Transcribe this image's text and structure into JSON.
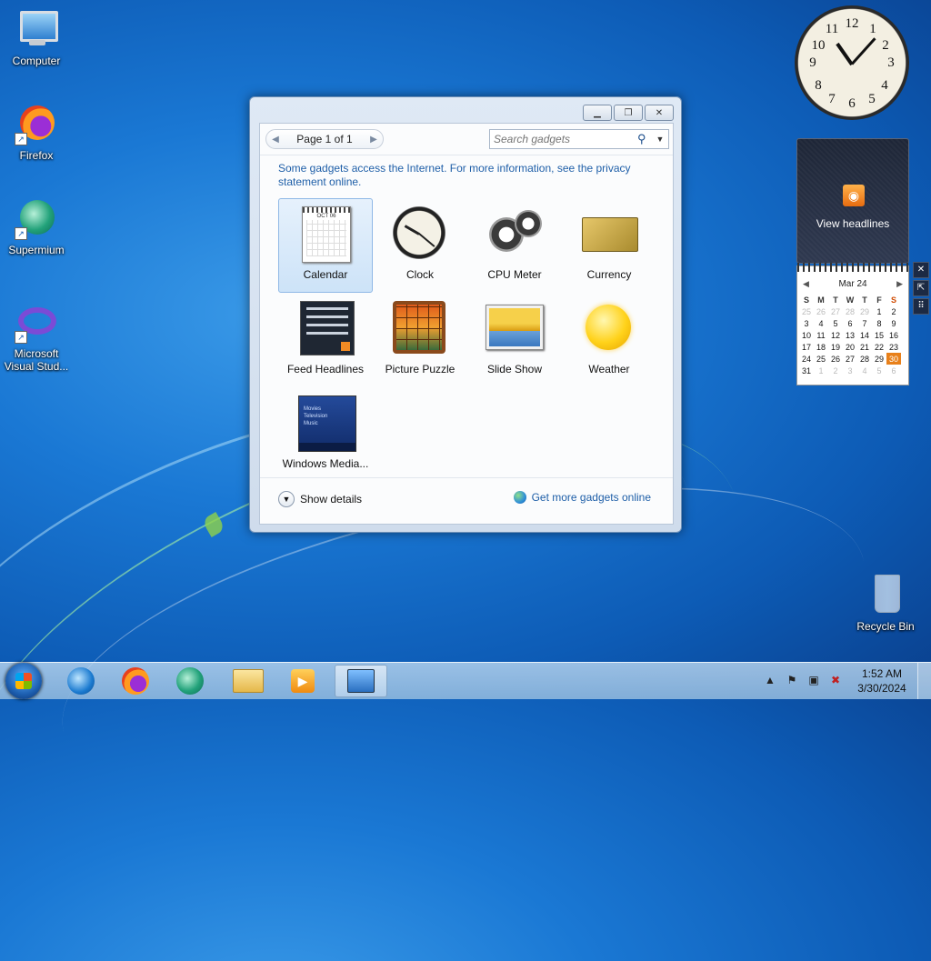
{
  "desktop": {
    "icons": [
      {
        "label": "Computer",
        "icon": "computer-icon"
      },
      {
        "label": "Firefox",
        "icon": "firefox-icon"
      },
      {
        "label": "Supermium",
        "icon": "supermium-icon"
      },
      {
        "label": "Microsoft Visual Stud...",
        "icon": "visual-studio-icon"
      },
      {
        "label": "Recycle Bin",
        "icon": "recycle-bin-icon"
      }
    ]
  },
  "gadget_window": {
    "pager_text": "Page 1 of 1",
    "search_placeholder": "Search gadgets",
    "notice_text": "Some gadgets access the Internet.  For more information, see the privacy statement online.",
    "gadgets": [
      {
        "label": "Calendar"
      },
      {
        "label": "Clock"
      },
      {
        "label": "CPU Meter"
      },
      {
        "label": "Currency"
      },
      {
        "label": "Feed Headlines"
      },
      {
        "label": "Picture Puzzle"
      },
      {
        "label": "Slide Show"
      },
      {
        "label": "Weather"
      },
      {
        "label": "Windows Media..."
      }
    ],
    "selected_gadget": "Calendar",
    "show_details": "Show details",
    "get_more": "Get more gadgets online",
    "calendar_thumb_month": "OCT 06"
  },
  "clock_gadget": {
    "numbers": [
      "12",
      "1",
      "2",
      "3",
      "4",
      "5",
      "6",
      "7",
      "8",
      "9",
      "10",
      "11"
    ]
  },
  "headlines_gadget": {
    "label": "View headlines"
  },
  "calendar_gadget": {
    "month": "Mar 24",
    "weekdays": [
      "S",
      "M",
      "T",
      "W",
      "T",
      "F",
      "S"
    ],
    "weeks": [
      [
        "25",
        "26",
        "27",
        "28",
        "29",
        "1",
        "2"
      ],
      [
        "3",
        "4",
        "5",
        "6",
        "7",
        "8",
        "9"
      ],
      [
        "10",
        "11",
        "12",
        "13",
        "14",
        "15",
        "16"
      ],
      [
        "17",
        "18",
        "19",
        "20",
        "21",
        "22",
        "23"
      ],
      [
        "24",
        "25",
        "26",
        "27",
        "28",
        "29",
        "30"
      ],
      [
        "31",
        "1",
        "2",
        "3",
        "4",
        "5",
        "6"
      ]
    ],
    "today": "30"
  },
  "taskbar": {
    "time": "1:52 AM",
    "date": "3/30/2024",
    "pinned": [
      {
        "name": "internet-explorer-icon"
      },
      {
        "name": "firefox-icon"
      },
      {
        "name": "supermium-icon"
      },
      {
        "name": "explorer-icon"
      },
      {
        "name": "media-player-icon"
      },
      {
        "name": "gadgets-icon"
      }
    ]
  },
  "colors": {
    "desktop_blue": "#1a78d4",
    "link_blue": "#1f5fa8",
    "today_orange": "#e8801a"
  }
}
